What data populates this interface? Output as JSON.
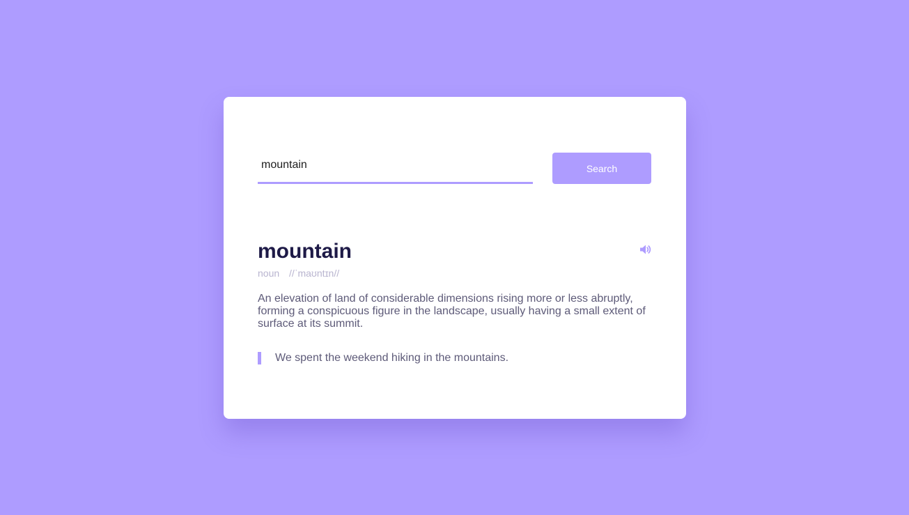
{
  "colors": {
    "background": "#ae9cff",
    "card": "#ffffff",
    "accent": "#ae9cff",
    "word": "#1e1a47",
    "meta": "#b8b4cf",
    "body_text": "#5d5a78"
  },
  "search": {
    "value": "mountain",
    "button_label": "Search"
  },
  "result": {
    "word": "mountain",
    "part_of_speech": "noun",
    "phonetic": "//ˈmaʊntɪn//",
    "sound_icon": "volume-icon",
    "definition": "An elevation of land of considerable dimensions rising more or less abruptly, forming a conspicuous figure in the landscape, usually having a small extent of surface at its summit.",
    "example": "We spent the weekend hiking in the mountains."
  }
}
